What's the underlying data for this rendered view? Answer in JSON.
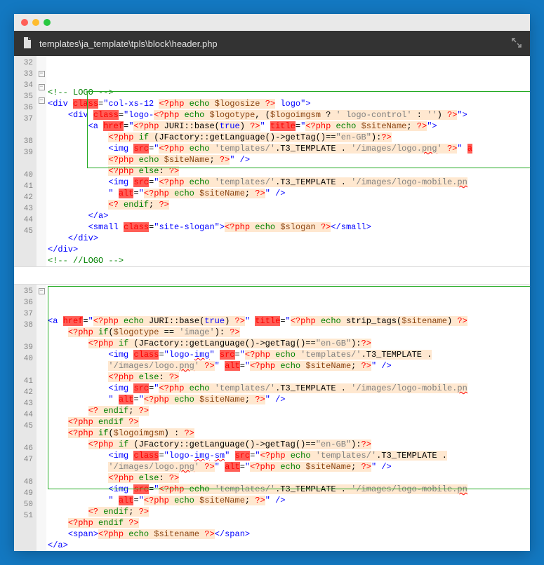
{
  "window": {
    "file_path": "templates\\ja_template\\tpls\\block\\header.php"
  },
  "pane1": {
    "line_start": 32,
    "lines": [
      {
        "n": 32,
        "fold": "",
        "html": "<span class='grn'>&lt;!-- LOGO --&gt;</span>"
      },
      {
        "n": 33,
        "fold": "-",
        "html": "<span class='blue'>&lt;div</span> <span class='red'>class</span>=<span class='blue'>\"col-xs-12 </span><span class='red hl'>&lt;?php</span><span class='hl'> </span><span class='grn hl'>echo</span><span class='hl'> </span><span class='brn hl'>$logosize</span><span class='hl'> </span><span class='red hl'>?&gt;</span><span class='blue'> logo\"</span><span class='blue'>&gt;</span>"
      },
      {
        "n": 34,
        "fold": "-",
        "html": "    <span class='blue'>&lt;div</span> <span class='red'>class</span>=<span class='blue'>\"logo-</span><span class='red hl'>&lt;?php</span><span class='hl'> </span><span class='grn hl'>echo</span><span class='hl'> </span><span class='brn hl'>$logotype</span><span class='hl'>, (</span><span class='brn hl'>$logoimgsm</span><span class='hl'> ? </span><span class='gry hl'>' logo-control'</span><span class='hl'> : </span><span class='gry hl'>''</span><span class='hl'>) </span><span class='red hl'>?&gt;</span><span class='blue'>\"&gt;</span>"
      },
      {
        "n": 35,
        "fold": "-",
        "html": "        <span class='blue'>&lt;a</span> <span class='red'>href</span>=<span class='blue'>\"</span><span class='red hl'>&lt;?php</span><span class='hl'> JURI::base(</span><span class='blue hl'>true</span><span class='hl'>) </span><span class='red hl'>?&gt;</span><span class='blue'>\"</span> <span class='red'>title</span>=<span class='blue'>\"</span><span class='red hl'>&lt;?php</span><span class='hl'> </span><span class='grn hl'>echo</span><span class='hl'> </span><span class='brn hl'>$siteName</span><span class='hl'>; </span><span class='red hl'>?&gt;</span><span class='blue'>\"&gt;</span>"
      },
      {
        "n": 36,
        "fold": "",
        "html": "            <span class='red hl'>&lt;?php</span><span class='hl'> </span><span class='grn hl'>if</span><span class='hl'> (JFactory::getLanguage()-&gt;getTag()==</span><span class='gry hl'>\"en-GB\"</span><span class='hl'>):</span><span class='red hl'>?&gt;</span>"
      },
      {
        "n": 37,
        "fold": "",
        "html": "            <span class='blue'>&lt;img</span> <span class='red'>src</span>=<span class='blue'>\"</span><span class='red hl'>&lt;?php</span><span class='hl'> </span><span class='grn hl'>echo</span><span class='hl'> </span><span class='gry hl'>'templates/'</span><span class='hl'>.T3_TEMPLATE . </span><span class='gry hl'>'/images/logo.<span class='wavy'>png</span>'</span><span class='hl'> </span><span class='red hl'>?&gt;</span><span class='blue'>\"</span> <span class='red'>a</span>"
      },
      {
        "n": "",
        "fold": "",
        "html": "            <span class='red hl'>&lt;?php</span><span class='hl'> </span><span class='grn hl'>echo</span><span class='hl'> </span><span class='brn hl'>$siteName</span><span class='hl'>; </span><span class='red hl'>?&gt;</span><span class='blue'>\" /&gt;</span>"
      },
      {
        "n": 38,
        "fold": "",
        "html": "            <span class='red hl'>&lt;?php</span><span class='hl'> </span><span class='grn hl'>else</span><span class='hl'>: </span><span class='red hl'>?&gt;</span>"
      },
      {
        "n": 39,
        "fold": "",
        "html": "            <span class='blue'>&lt;img</span> <span class='red'>src</span>=<span class='blue'>\"</span><span class='red hl'>&lt;?php</span><span class='hl'> </span><span class='grn hl'>echo</span><span class='hl'> </span><span class='gry hl'>'templates/'</span><span class='hl'>.T3_TEMPLATE . </span><span class='gry hl'>'/images/logo-mobile.<span class='wavy'>pn</span></span>"
      },
      {
        "n": "",
        "fold": "",
        "html": "            <span class='blue'>\"</span> <span class='red'>alt</span>=<span class='blue'>\"</span><span class='red hl'>&lt;?php</span><span class='hl'> </span><span class='grn hl'>echo</span><span class='hl'> </span><span class='brn hl'>$siteName</span><span class='hl'>; </span><span class='red hl'>?&gt;</span><span class='blue'>\" /&gt;</span>"
      },
      {
        "n": 40,
        "fold": "",
        "html": "            <span class='red hl'>&lt;?</span><span class='hl'> </span><span class='grn hl'>endif</span><span class='hl'>; </span><span class='red hl'>?&gt;</span>"
      },
      {
        "n": 41,
        "fold": "",
        "html": "        <span class='blue'>&lt;/a&gt;</span>"
      },
      {
        "n": 42,
        "fold": "",
        "html": "        <span class='blue'>&lt;small</span> <span class='red'>class</span>=<span class='blue'>\"site-slogan\"&gt;</span><span class='red hl'>&lt;?php</span><span class='hl'> </span><span class='grn hl'>echo</span><span class='hl'> </span><span class='brn hl'>$slogan</span><span class='hl'> </span><span class='red hl'>?&gt;</span><span class='blue'>&lt;/small&gt;</span>"
      },
      {
        "n": 43,
        "fold": "",
        "html": "    <span class='blue'>&lt;/div&gt;</span>"
      },
      {
        "n": 44,
        "fold": "",
        "html": "<span class='blue'>&lt;/div&gt;</span>"
      },
      {
        "n": 45,
        "fold": "",
        "html": "<span class='grn'>&lt;!-- //LOGO --&gt;</span>"
      }
    ]
  },
  "pane2": {
    "line_start": 35,
    "lines": [
      {
        "n": 35,
        "fold": "-",
        "html": "<span class='blue'>&lt;a</span> <span class='red'>href</span>=<span class='blue'>\"</span><span class='red hl'>&lt;?php</span><span class='hl'> </span><span class='grn hl'>echo</span><span class='hl'> JURI::base(</span><span class='blue hl'>true</span><span class='hl'>) </span><span class='red hl'>?&gt;</span><span class='blue'>\"</span> <span class='red'>title</span>=<span class='blue'>\"</span><span class='red hl'>&lt;?php</span><span class='hl'> </span><span class='grn hl'>echo</span><span class='hl'> strip_tags(</span><span class='brn hl'>$sitename</span><span class='hl'>) </span><span class='red hl'>?&gt;</span>"
      },
      {
        "n": 36,
        "fold": "",
        "html": "    <span class='red hl'>&lt;?php</span><span class='hl'> </span><span class='grn hl'>if</span><span class='hl'>(</span><span class='brn hl'>$logotype</span><span class='hl'> == </span><span class='gry hl'>'image'</span><span class='hl'>): </span><span class='red hl'>?&gt;</span>"
      },
      {
        "n": 37,
        "fold": "",
        "html": "        <span class='red hl'>&lt;?php</span><span class='hl'> </span><span class='grn hl'>if</span><span class='hl'> (JFactory::getLanguage()-&gt;getTag()==</span><span class='gry hl'>\"en-GB\"</span><span class='hl'>):</span><span class='red hl'>?&gt;</span>"
      },
      {
        "n": 38,
        "fold": "",
        "html": "            <span class='blue'>&lt;img</span> <span class='red'>class</span>=<span class='blue'>\"logo-<span class='wavy'>img</span>\"</span> <span class='red'>src</span>=<span class='blue'>\"</span><span class='red hl'>&lt;?php</span><span class='hl'> </span><span class='grn hl'>echo</span><span class='hl'> </span><span class='gry hl'>'templates/'</span><span class='hl'>.T3_TEMPLATE .</span>"
      },
      {
        "n": "",
        "fold": "",
        "html": "            <span class='gry hl'>'/images/logo.<span class='wavy'>png</span>'</span><span class='hl'> </span><span class='red hl'>?&gt;</span><span class='blue'>\"</span> <span class='red'>alt</span>=<span class='blue'>\"</span><span class='red hl'>&lt;?php</span><span class='hl'> </span><span class='grn hl'>echo</span><span class='hl'> </span><span class='brn hl'>$siteName</span><span class='hl'>; </span><span class='red hl'>?&gt;</span><span class='blue'>\" /&gt;</span>"
      },
      {
        "n": 39,
        "fold": "",
        "html": "            <span class='red hl'>&lt;?php</span><span class='hl'> </span><span class='grn hl'>else</span><span class='hl'>: </span><span class='red hl'>?&gt;</span>"
      },
      {
        "n": 40,
        "fold": "",
        "html": "            <span class='blue'>&lt;img</span> <span class='red'>src</span>=<span class='blue'>\"</span><span class='red hl'>&lt;?php</span><span class='hl'> </span><span class='grn hl'>echo</span><span class='hl'> </span><span class='gry hl'>'templates/'</span><span class='hl'>.T3_TEMPLATE . </span><span class='gry hl'>'/images/logo-mobile.<span class='wavy'>pn</span></span>"
      },
      {
        "n": "",
        "fold": "",
        "html": "            <span class='blue'>\"</span> <span class='red'>alt</span>=<span class='blue'>\"</span><span class='red hl'>&lt;?php</span><span class='hl'> </span><span class='grn hl'>echo</span><span class='hl'> </span><span class='brn hl'>$siteName</span><span class='hl'>; </span><span class='red hl'>?&gt;</span><span class='blue'>\" /&gt;</span>"
      },
      {
        "n": 41,
        "fold": "",
        "html": "        <span class='red hl'>&lt;?</span><span class='hl'> </span><span class='grn hl'>endif</span><span class='hl'>; </span><span class='red hl'>?&gt;</span>"
      },
      {
        "n": 42,
        "fold": "",
        "html": "    <span class='red hl'>&lt;?php</span><span class='hl'> </span><span class='grn hl'>endif</span><span class='hl'> </span><span class='red hl'>?&gt;</span>"
      },
      {
        "n": 43,
        "fold": "",
        "html": "    <span class='red hl'>&lt;?php</span><span class='hl'> </span><span class='grn hl'>if</span><span class='hl'>(</span><span class='brn hl'>$logoimgsm</span><span class='hl'>) : </span><span class='red hl'>?&gt;</span>"
      },
      {
        "n": 44,
        "fold": "",
        "html": "        <span class='red hl'>&lt;?php</span><span class='hl'> </span><span class='grn hl'>if</span><span class='hl'> (JFactory::getLanguage()-&gt;getTag()==</span><span class='gry hl'>\"en-GB\"</span><span class='hl'>):</span><span class='red hl'>?&gt;</span>"
      },
      {
        "n": 45,
        "fold": "",
        "html": "            <span class='blue'>&lt;img</span> <span class='red'>class</span>=<span class='blue'>\"logo-<span class='wavy'>img</span>-<span class='wavy'>sm</span>\"</span> <span class='red'>src</span>=<span class='blue'>\"</span><span class='red hl'>&lt;?php</span><span class='hl'> </span><span class='grn hl'>echo</span><span class='hl'> </span><span class='gry hl'>'templates/'</span><span class='hl'>.T3_TEMPLATE .</span>"
      },
      {
        "n": "",
        "fold": "",
        "html": "            <span class='gry hl'>'/images/logo.<span class='wavy'>png</span>'</span><span class='hl'> </span><span class='red hl'>?&gt;</span><span class='blue'>\"</span> <span class='red'>alt</span>=<span class='blue'>\"</span><span class='red hl'>&lt;?php</span><span class='hl'> </span><span class='grn hl'>echo</span><span class='hl'> </span><span class='brn hl'>$siteName</span><span class='hl'>; </span><span class='red hl'>?&gt;</span><span class='blue'>\" /&gt;</span>"
      },
      {
        "n": 46,
        "fold": "",
        "html": "            <span class='red hl'>&lt;?php</span><span class='hl'> </span><span class='grn hl'>else</span><span class='hl'>: </span><span class='red hl'>?&gt;</span>"
      },
      {
        "n": 47,
        "fold": "",
        "html": "            <span class='blue'>&lt;img</span> <span class='red'>src</span>=<span class='blue'>\"</span><span class='red hl'>&lt;?php</span><span class='hl'> </span><span class='grn hl'>echo</span><span class='hl'> </span><span class='gry hl'>'templates/'</span><span class='hl'>.T3_TEMPLATE . </span><span class='gry hl'>'/images/logo-mobile.<span class='wavy'>pn</span></span>"
      },
      {
        "n": "",
        "fold": "",
        "html": "            <span class='blue'>\"</span> <span class='red'>alt</span>=<span class='blue'>\"</span><span class='red hl'>&lt;?php</span><span class='hl'> </span><span class='grn hl'>echo</span><span class='hl'> </span><span class='brn hl'>$siteName</span><span class='hl'>; </span><span class='red hl'>?&gt;</span><span class='blue'>\" /&gt;</span>"
      },
      {
        "n": 48,
        "fold": "",
        "html": "        <span class='red hl'>&lt;?</span><span class='hl'> </span><span class='grn hl'>endif</span><span class='hl'>; </span><span class='red hl'>?&gt;</span>"
      },
      {
        "n": 49,
        "fold": "",
        "html": "    <span class='red hl'>&lt;?php</span><span class='hl'> </span><span class='grn hl'>endif</span><span class='hl'> </span><span class='red hl'>?&gt;</span>"
      },
      {
        "n": 50,
        "fold": "",
        "html": "    <span class='blue'>&lt;span&gt;</span><span class='red hl'>&lt;?php</span><span class='hl'> </span><span class='grn hl'>echo</span><span class='hl'> </span><span class='brn hl'>$sitename</span><span class='hl'> </span><span class='red hl'>?&gt;</span><span class='blue'>&lt;/span&gt;</span>"
      },
      {
        "n": 51,
        "fold": "",
        "html": "<span class='blue'>&lt;/a&gt;</span>"
      }
    ]
  }
}
